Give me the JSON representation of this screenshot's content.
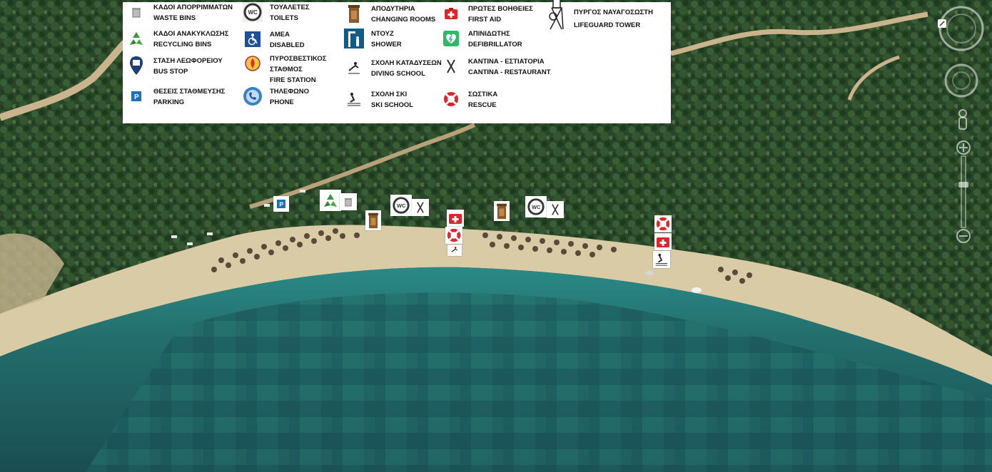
{
  "legend": {
    "items": [
      {
        "icon": "trash-can-icon",
        "gr": "ΚΑΔΟΙ ΑΠΟΡΡΙΜΜΑΤΩΝ",
        "en": "WASTE BINS"
      },
      {
        "icon": "recycling-icon",
        "gr": "ΚΑΔΟΙ ΑΝΑΚΥΚΛΩΣΗΣ",
        "en": "RECYCLING BINS"
      },
      {
        "icon": "bus-stop-icon",
        "gr": "ΣΤΑΣΗ ΛΕΩΦΟΡΕΙΟΥ",
        "en": "BUS STOP"
      },
      {
        "icon": "parking-icon",
        "gr": "ΘΕΣΕΙΣ ΣΤΑΘΜΕΥΣΗΣ",
        "en": "PARKING"
      },
      {
        "icon": "wc-icon",
        "gr": "ΤΟΥΑΛΕΤΕΣ",
        "en": "TOILETS"
      },
      {
        "icon": "wheelchair-icon",
        "gr": "ΑΜΕΑ",
        "en": "DISABLED"
      },
      {
        "icon": "fire-station-icon",
        "gr": "ΠΥΡΟΣΒΕΣΤΙΚΟΣ ΣΤΑΘΜΟΣ",
        "en": "FIRE STATION"
      },
      {
        "icon": "phone-icon",
        "gr": "ΤΗΛΕΦΩΝΟ",
        "en": "PHONE"
      },
      {
        "icon": "changing-room-icon",
        "gr": "ΑΠΟΔΥΤΗΡΙΑ",
        "en": "CHANGING ROOMS"
      },
      {
        "icon": "shower-icon",
        "gr": "ΝΤΟΥΖ",
        "en": "SHOWER"
      },
      {
        "icon": "diving-icon",
        "gr": "ΣΧΟΛΗ ΚΑΤΑΔΥΣΕΩΝ",
        "en": "DIVING SCHOOL"
      },
      {
        "icon": "ski-icon",
        "gr": "ΣΧΟΛΗ ΣΚΙ",
        "en": "SKI SCHOOL"
      },
      {
        "icon": "first-aid-icon",
        "gr": "ΠΡΩΤΕΣ ΒΟΗΘΕΙΕΣ",
        "en": "FIRST AID"
      },
      {
        "icon": "defibrillator-icon",
        "gr": "ΑΠΙΝΙΔΩΤΗΣ",
        "en": "DEFIBRILLATOR"
      },
      {
        "icon": "cantina-icon",
        "gr": "ΚΑΝΤΙΝΑ - ΕΣΤΙΑΤΟΡΙΑ",
        "en": "CANTINA - RESTAURANT"
      },
      {
        "icon": "lifebuoy-icon",
        "gr": "ΣΩΣΤΙΚΑ",
        "en": "RESCUE"
      },
      {
        "icon": "lifeguard-tower-icon",
        "gr": "ΠΥΡΓΟΣ ΝΑΥΑΓΟΣΩΣΤΗ",
        "en": "LIFEGUARD TOWER"
      }
    ]
  },
  "map_markers": [
    "parking-icon",
    "recycling-icon",
    "trash-can-icon",
    "changing-room-icon",
    "wc-icon",
    "cantina-icon",
    "first-aid-icon",
    "lifebuoy-icon",
    "wheelchair-icon",
    "changing-room-icon",
    "wc-icon",
    "cantina-icon",
    "lifebuoy-icon",
    "first-aid-icon",
    "ski-icon"
  ],
  "colors": {
    "sea": "#1f6e6a",
    "forest": "#2b4a2a",
    "sand": "#d9cba6",
    "red": "#e0242a",
    "blue": "#1d5aa6"
  }
}
